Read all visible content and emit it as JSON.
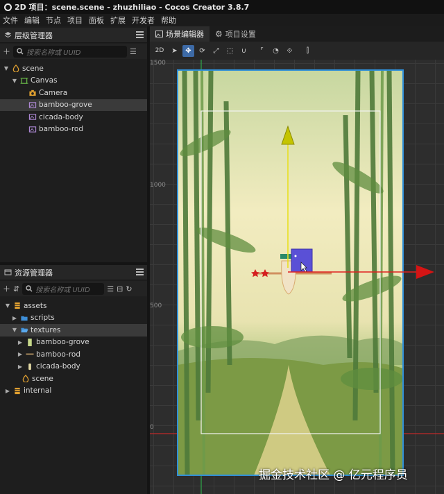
{
  "window": {
    "title": "2D 项目：scene.scene - zhuzhiliao - Cocos Creator 3.8.7"
  },
  "menu": [
    "文件",
    "编辑",
    "节点",
    "项目",
    "面板",
    "扩展",
    "开发者",
    "帮助"
  ],
  "hierarchy": {
    "title": "层级管理器",
    "search_placeholder": "搜索名称或 UUID",
    "nodes": [
      {
        "label": "scene",
        "depth": 0,
        "expanded": true,
        "icon": "scene-icon"
      },
      {
        "label": "Canvas",
        "depth": 1,
        "expanded": true,
        "icon": "canvas-icon"
      },
      {
        "label": "Camera",
        "depth": 2,
        "icon": "camera-icon"
      },
      {
        "label": "bamboo-grove",
        "depth": 2,
        "icon": "sprite-icon",
        "selected": true
      },
      {
        "label": "cicada-body",
        "depth": 2,
        "icon": "sprite-icon"
      },
      {
        "label": "bamboo-rod",
        "depth": 2,
        "icon": "sprite-icon"
      }
    ]
  },
  "assets": {
    "title": "资源管理器",
    "search_placeholder": "搜索名称或 UUID",
    "nodes": [
      {
        "label": "assets",
        "depth": 0,
        "expanded": true,
        "icon": "db-icon"
      },
      {
        "label": "scripts",
        "depth": 1,
        "expanded": false,
        "icon": "folder-icon"
      },
      {
        "label": "textures",
        "depth": 1,
        "expanded": true,
        "icon": "folder-open-icon",
        "selected": true
      },
      {
        "label": "bamboo-grove",
        "depth": 2,
        "expanded": false,
        "icon": "texture-icon"
      },
      {
        "label": "bamboo-rod",
        "depth": 2,
        "expanded": false,
        "icon": "texture-icon"
      },
      {
        "label": "cicada-body",
        "depth": 2,
        "expanded": false,
        "icon": "texture-icon"
      },
      {
        "label": "scene",
        "depth": 1,
        "icon": "scene-icon"
      },
      {
        "label": "internal",
        "depth": 0,
        "expanded": false,
        "icon": "db-icon"
      }
    ]
  },
  "editor": {
    "tabs": [
      {
        "label": "场景编辑器",
        "active": true
      },
      {
        "label": "项目设置",
        "active": false
      }
    ],
    "toolbar_2d": "2D",
    "rulers": [
      "1500",
      "1000",
      "500",
      "0"
    ],
    "watermark": "掘金技术社区 @ 亿元程序员"
  },
  "colors": {
    "accent": "#3d6aa6",
    "selection": "#3a3a3a",
    "canvas_border": "#2f8fd8"
  }
}
